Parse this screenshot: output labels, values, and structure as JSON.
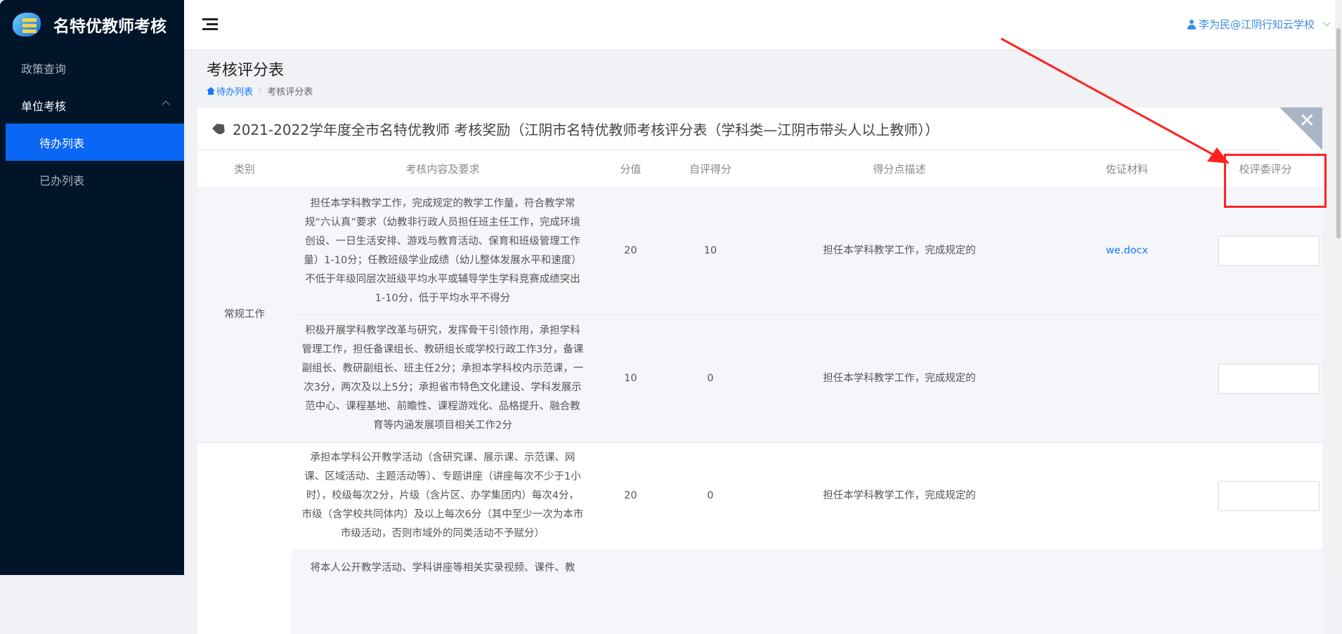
{
  "app": {
    "title": "名特优教师考核"
  },
  "sidebar": {
    "items": [
      {
        "label": "政策查询"
      },
      {
        "label": "单位考核"
      },
      {
        "label": "待办列表"
      },
      {
        "label": "已办列表"
      }
    ]
  },
  "topbar": {
    "user": "李为民@江阴行知云学校"
  },
  "page": {
    "title": "考核评分表",
    "breadcrumb": [
      "待办列表",
      "考核评分表"
    ]
  },
  "card": {
    "title": "2021-2022学年度全市名特优教师 考核奖励（江阴市名特优教师考核评分表（学科类—江阴市带头人以上教师））",
    "close": "✕"
  },
  "table": {
    "headers": [
      "类别",
      "考核内容及要求",
      "分值",
      "自评得分",
      "得分点描述",
      "佐证材料",
      "校评委评分"
    ],
    "category1": "常规工作",
    "rows": [
      {
        "content": "担任本学科教学工作，完成规定的教学工作量，符合教学常规“六认真”要求（幼教非行政人员担任班主任工作，完成环境创设、一日生活安排、游戏与教育活动、保育和班级管理工作量）1-10分；任教班级学业成绩（幼儿整体发展水平和速度）不低于年级同层次班级平均水平或辅导学生学科竞赛成绩突出1-10分，低于平均水平不得分",
        "score": "20",
        "self": "10",
        "desc": "担任本学科教学工作，完成规定的",
        "evidence": "we.docx",
        "review": ""
      },
      {
        "content": "积极开展学科教学改革与研究，发挥骨干引领作用，承担学科管理工作，担任备课组长、教研组长或学校行政工作3分，备课副组长、教研副组长、班主任2分；承担本学科校内示范课，一次3分，两次及以上5分；承担省市特色文化建设、学科发展示范中心、课程基地、前瞻性、课程游戏化、品格提升、融合教育等内涵发展项目相关工作2分",
        "score": "10",
        "self": "0",
        "desc": "担任本学科教学工作，完成规定的",
        "evidence": "",
        "review": ""
      },
      {
        "content": "承担本学科公开教学活动（含研究课、展示课、示范课、网课、区域活动、主题活动等）、专题讲座（讲座每次不少于1小时），校级每次2分，片级（含片区、办学集团内）每次4分，市级（含学校共同体内）及以上每次6分（其中至少一次为本市市级活动，否则市域外的同类活动不予赋分）",
        "score": "20",
        "self": "0",
        "desc": "担任本学科教学工作，完成规定的",
        "evidence": "",
        "review": ""
      },
      {
        "content": "将本人公开教学活动、学科讲座等相关实录视频、课件、教",
        "score": "",
        "self": "",
        "desc": "",
        "evidence": "",
        "review": ""
      }
    ]
  },
  "colors": {
    "sidebar": "#001529",
    "active": "#0a66f5",
    "link": "#1677ff",
    "annotation": "#ff2222"
  }
}
